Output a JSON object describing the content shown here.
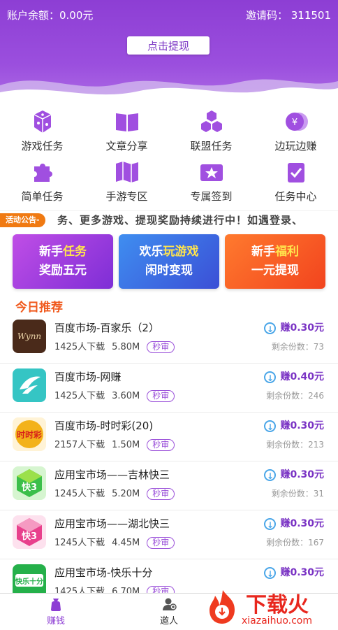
{
  "header": {
    "balance_label": "账户余额：0.00元",
    "invite_label": "邀请码：  311501",
    "withdraw_button": "点击提现"
  },
  "grid": [
    {
      "label": "游戏任务",
      "icon": "dice-icon"
    },
    {
      "label": "文章分享",
      "icon": "book-icon"
    },
    {
      "label": "联盟任务",
      "icon": "hexagons-icon"
    },
    {
      "label": "边玩边赚",
      "icon": "coins-icon"
    },
    {
      "label": "简单任务",
      "icon": "puzzle-icon"
    },
    {
      "label": "手游专区",
      "icon": "map-icon"
    },
    {
      "label": "专属签到",
      "icon": "ticket-icon"
    },
    {
      "label": "任务中心",
      "icon": "checklist-icon"
    }
  ],
  "notice": {
    "tag": "活动公告-",
    "text": "务、更多游戏、提现奖励持续进行中！如遇登录、"
  },
  "banners": [
    {
      "line1_a": "新手",
      "line1_b": "任务",
      "line2": "奖励五元"
    },
    {
      "line1_a": "欢乐",
      "line1_b": "玩游戏",
      "line2": "闲时变现"
    },
    {
      "line1_a": "新手",
      "line1_b": "福利",
      "line2": "一元提现"
    }
  ],
  "section_title": "今日推荐",
  "apps": [
    {
      "name": "百度市场-百家乐（2）",
      "downloads": "1425人下载",
      "size": "5.80M",
      "tag": "秒审",
      "reward": "赚0.30元",
      "remain": "剩余份数：73",
      "icon_color": "#4a2a1a",
      "icon_text": "Wynn"
    },
    {
      "name": "百度市场-网赚",
      "downloads": "1425人下载",
      "size": "3.60M",
      "tag": "秒审",
      "reward": "赚0.40元",
      "remain": "剩余份数：246",
      "icon_color": "#35c5c4",
      "icon_text": ""
    },
    {
      "name": "百度市场-时时彩(20)",
      "downloads": "2157人下载",
      "size": "1.50M",
      "tag": "秒审",
      "reward": "赚0.30元",
      "remain": "剩余份数：213",
      "icon_color": "#f3b21a",
      "icon_text": "时时彩"
    },
    {
      "name": "应用宝市场——吉林快三",
      "downloads": "1245人下载",
      "size": "5.20M",
      "tag": "秒审",
      "reward": "赚0.30元",
      "remain": "剩余份数：31",
      "icon_color": "#3bbf4a",
      "icon_text": "快3"
    },
    {
      "name": "应用宝市场——湖北快三",
      "downloads": "1245人下载",
      "size": "4.45M",
      "tag": "秒审",
      "reward": "赚0.30元",
      "remain": "剩余份数：167",
      "icon_color": "#e8408c",
      "icon_text": "快3"
    },
    {
      "name": "应用宝市场-快乐十分",
      "downloads": "1425人下载",
      "size": "6.70M",
      "tag": "秒审",
      "reward": "赚0.30元",
      "remain": "",
      "icon_color": "#25b04a",
      "icon_text": "快乐十分"
    }
  ],
  "tabs": [
    {
      "label": "赚钱",
      "active": true
    },
    {
      "label": "邀人",
      "active": false
    }
  ],
  "watermark": {
    "text": "下载火",
    "url": "xiazaihuo.com"
  },
  "colors": {
    "brand": "#8d3ed4",
    "accent": "#f05a1e",
    "reward": "#7a33c4"
  }
}
